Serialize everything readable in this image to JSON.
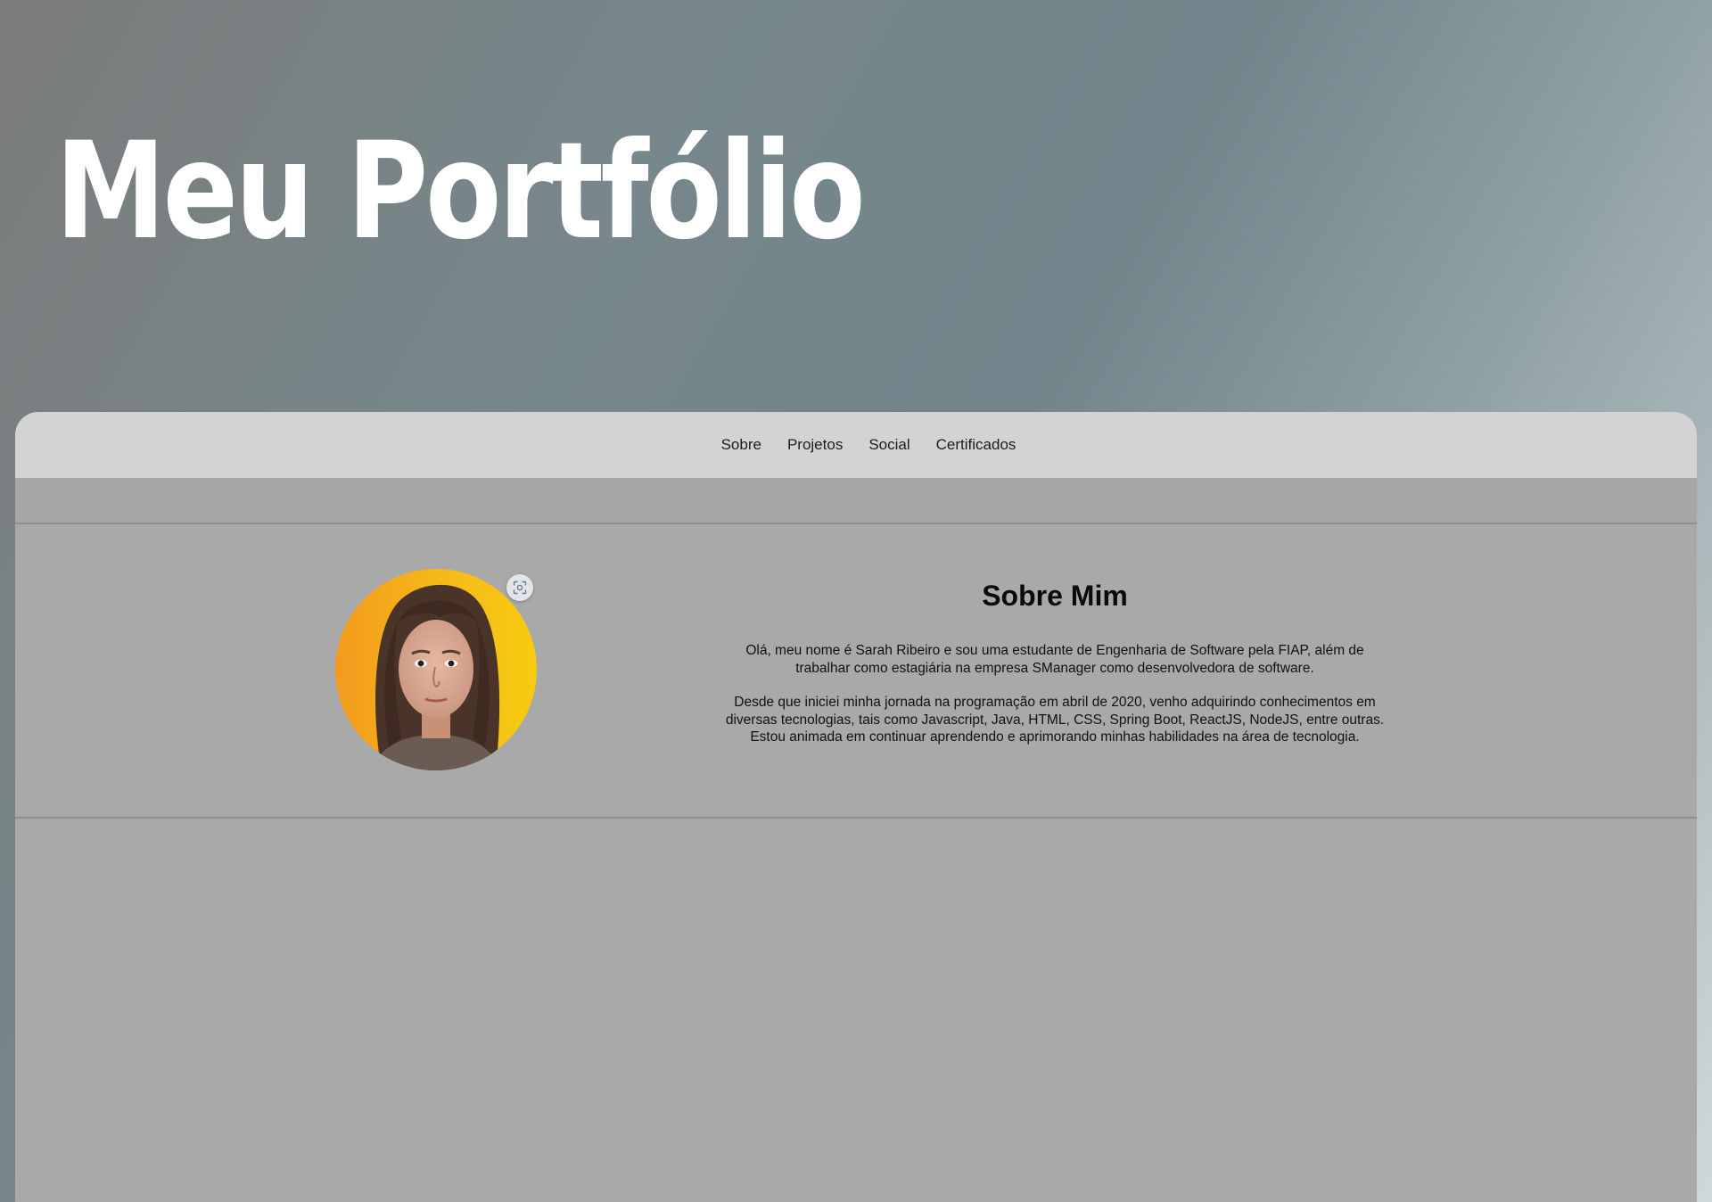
{
  "hero": {
    "title": "Meu Portfólio"
  },
  "nav": {
    "items": [
      {
        "label": "Sobre"
      },
      {
        "label": "Projetos"
      },
      {
        "label": "Social"
      },
      {
        "label": "Certificados"
      }
    ]
  },
  "about": {
    "title": "Sobre Mim",
    "paragraphs": [
      "Olá, meu nome é Sarah Ribeiro e sou uma estudante de Engenharia de Software pela FIAP, além de trabalhar como estagiária na empresa SManager como desenvolvedora de software.",
      "Desde que iniciei minha jornada na programação em abril de 2020, venho adquirindo conhecimentos em diversas tecnologias, tais como Javascript, Java, HTML, CSS, Spring Boot, ReactJS, NodeJS, entre outras. Estou animada em continuar aprendendo e aprimorando minhas habilidades na área de tecnologia."
    ],
    "avatar_icon": "profile-photo",
    "lens_icon": "visual-lookup-icon"
  },
  "colors": {
    "navbar_bg": "#d3d3d3",
    "content_bg": "#a9a9a9",
    "avatar_gradient_start": "#f39a1e",
    "avatar_gradient_end": "#f7cc10"
  }
}
